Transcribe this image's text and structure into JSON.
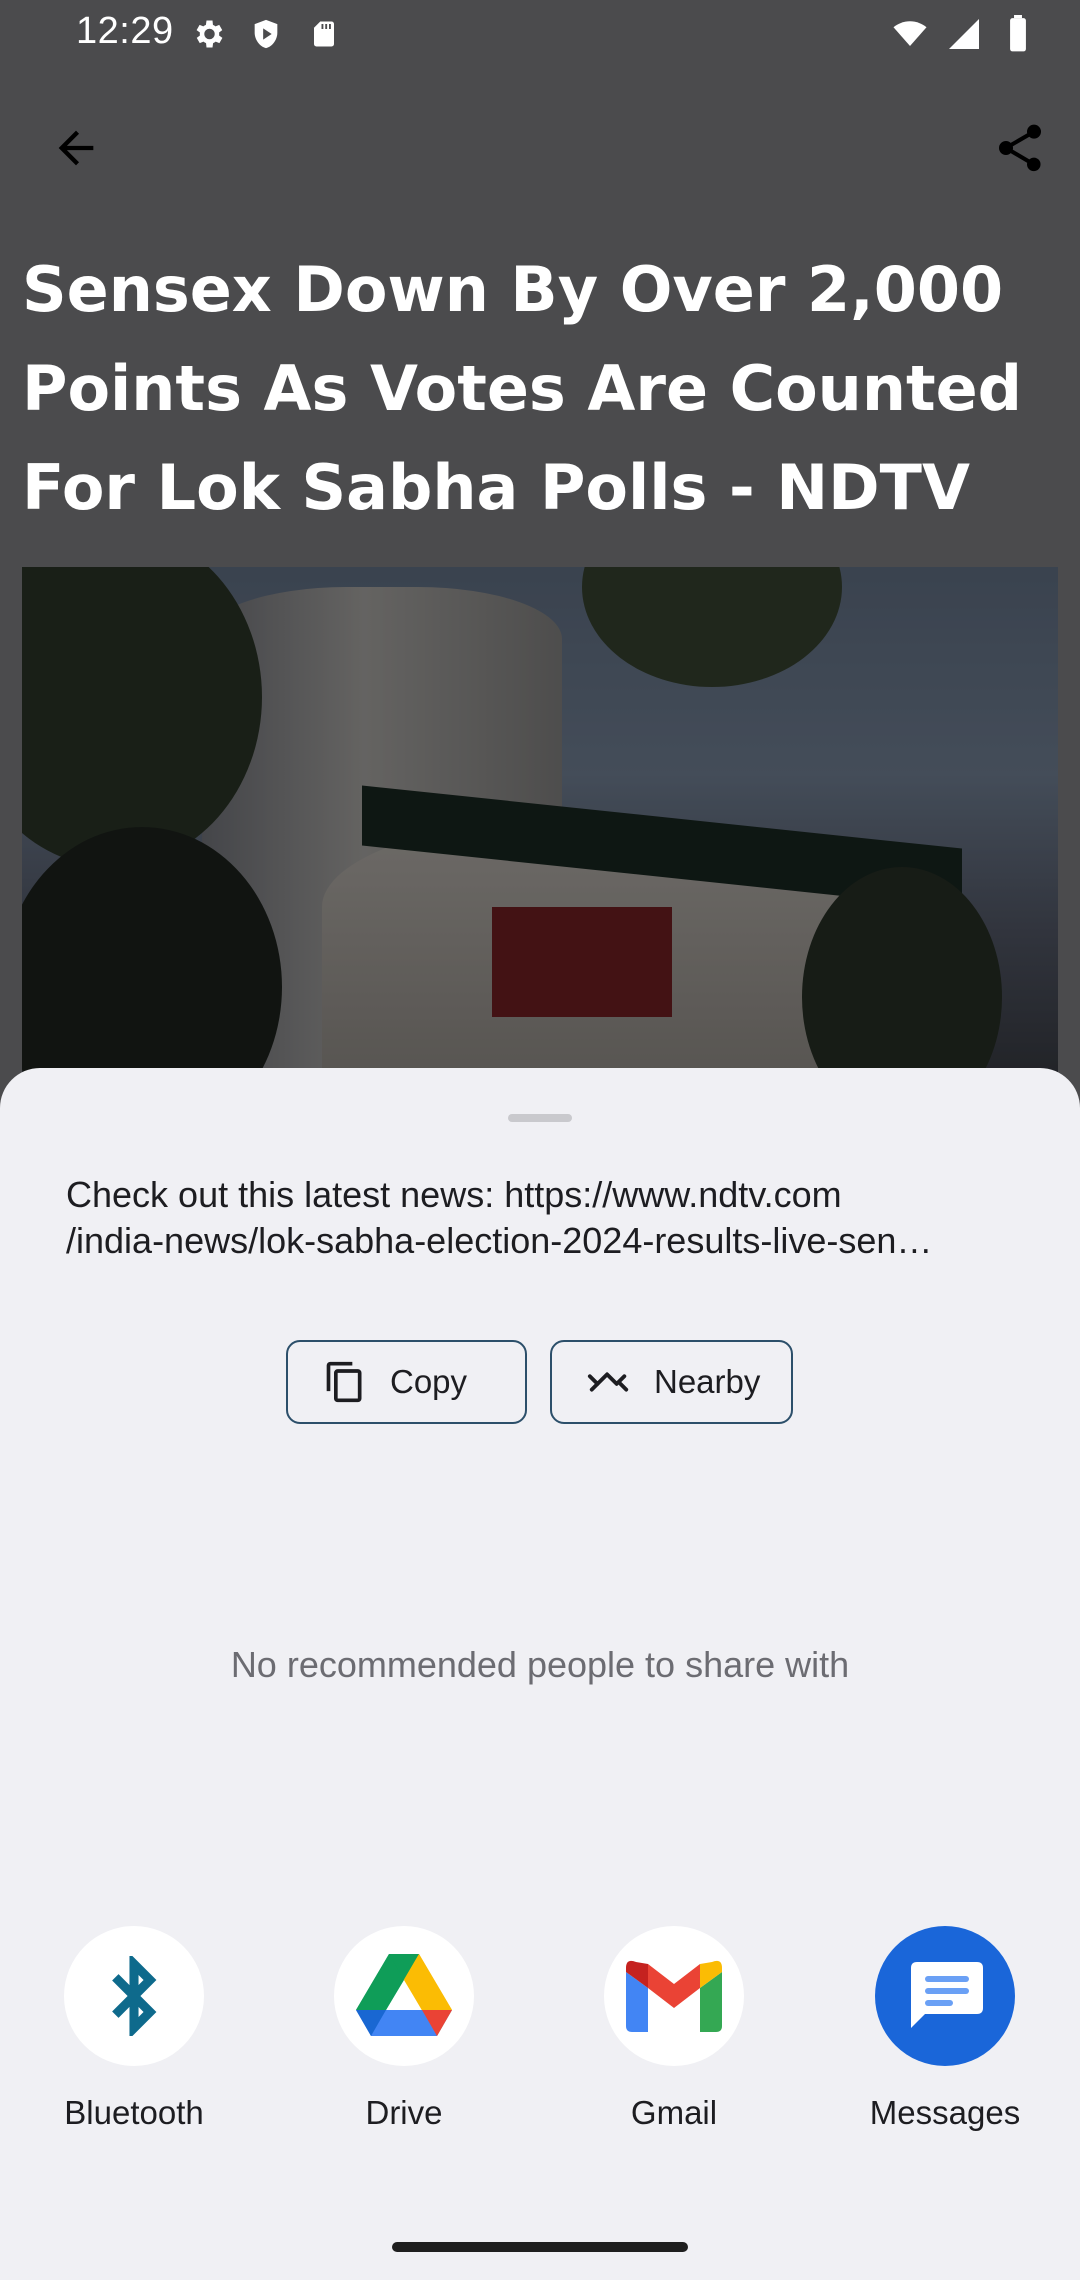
{
  "status_bar": {
    "time": "12:29",
    "left_icons": [
      "settings-gear-icon",
      "shield-icon",
      "sd-card-icon"
    ],
    "right_icons": [
      "wifi-icon",
      "signal-icon",
      "battery-icon"
    ]
  },
  "toolbar": {
    "back_icon": "arrow-back-icon",
    "share_icon": "share-icon"
  },
  "article": {
    "title": "Sensex Down By Over 2,000 Points As Votes Are Counted For Lok Sabha Polls - NDTV"
  },
  "share_sheet": {
    "text_line1": "Check out this latest news: https://www.ndtv.com",
    "text_line2": "/india-news/lok-sabha-election-2024-results-live-sen…",
    "copy_label": "Copy",
    "nearby_label": "Nearby",
    "empty_people_text": "No recommended people to share with",
    "targets": [
      {
        "label": "Bluetooth",
        "icon": "bluetooth-icon"
      },
      {
        "label": "Drive",
        "icon": "drive-icon"
      },
      {
        "label": "Gmail",
        "icon": "gmail-icon"
      },
      {
        "label": "Messages",
        "icon": "messages-icon"
      }
    ]
  },
  "colors": {
    "scrim": "#4b4b4d",
    "sheet_bg": "#f0f0f4",
    "chip_border": "#2c4f6a",
    "messages_blue": "#1a66d9",
    "bluetooth_blue": "#0e6a8c"
  }
}
